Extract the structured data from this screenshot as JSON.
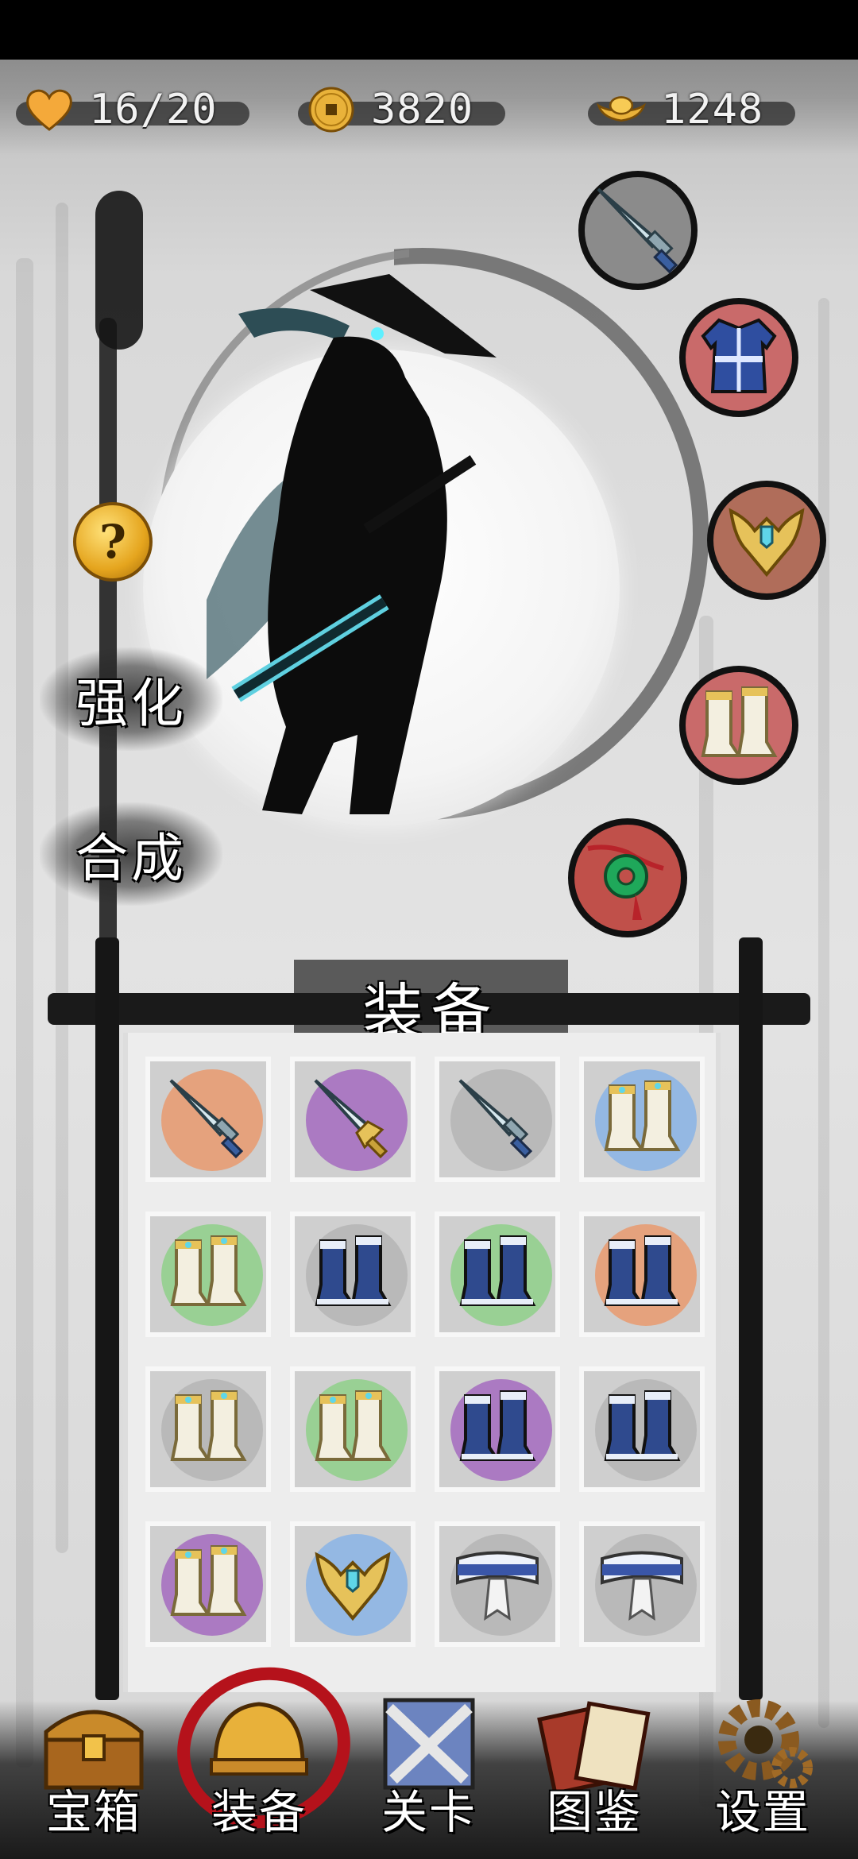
{
  "resources": {
    "stamina": {
      "icon": "heart-icon",
      "value": "16/20"
    },
    "coins": {
      "icon": "coin-icon",
      "value": "3820"
    },
    "gold_ingots": {
      "icon": "gold-ingot-icon",
      "value": "1248"
    }
  },
  "character": {
    "name": "ninja-silhouette"
  },
  "help": {
    "label": "?"
  },
  "actions": {
    "enhance_label": "强化",
    "synthesize_label": "合成"
  },
  "equipped_slots": [
    {
      "slot": "weapon",
      "icon": "sword-icon",
      "bg": "#8b8b8b"
    },
    {
      "slot": "armor",
      "icon": "robe-icon",
      "bg": "#c96a6a"
    },
    {
      "slot": "helmet",
      "icon": "helmet-icon",
      "bg": "#b06d5a"
    },
    {
      "slot": "boots",
      "icon": "boots-icon",
      "bg": "#c96a6a"
    },
    {
      "slot": "accessory",
      "icon": "jade-pendant-icon",
      "bg": "#c0504a"
    }
  ],
  "inventory": {
    "title": "装备",
    "items": [
      {
        "icon": "sword-icon",
        "rarity_color": "#e99a6e"
      },
      {
        "icon": "golden-sword-icon",
        "rarity_color": "#a56bc0"
      },
      {
        "icon": "sword-icon",
        "rarity_color": "#b5b5b5"
      },
      {
        "icon": "white-boots-icon",
        "rarity_color": "#8ab4e6"
      },
      {
        "icon": "white-boots-icon",
        "rarity_color": "#8fd08a"
      },
      {
        "icon": "blue-boots-icon",
        "rarity_color": "#b5b5b5"
      },
      {
        "icon": "blue-boots-icon",
        "rarity_color": "#8fd08a"
      },
      {
        "icon": "blue-boots-icon",
        "rarity_color": "#e99a6e"
      },
      {
        "icon": "white-boots-icon",
        "rarity_color": "#b5b5b5"
      },
      {
        "icon": "white-boots-icon",
        "rarity_color": "#8fd08a"
      },
      {
        "icon": "blue-boots-icon",
        "rarity_color": "#a56bc0"
      },
      {
        "icon": "blue-boots-icon",
        "rarity_color": "#b5b5b5"
      },
      {
        "icon": "white-boots-icon",
        "rarity_color": "#a56bc0"
      },
      {
        "icon": "helmet-icon",
        "rarity_color": "#8ab4e6"
      },
      {
        "icon": "belt-icon",
        "rarity_color": "#b5b5b5"
      },
      {
        "icon": "belt-icon",
        "rarity_color": "#b5b5b5"
      }
    ]
  },
  "nav": [
    {
      "label": "宝箱",
      "icon": "treasure-chest-icon"
    },
    {
      "label": "装备",
      "icon": "helmet-icon",
      "active": true
    },
    {
      "label": "关卡",
      "icon": "crossed-swords-icon"
    },
    {
      "label": "图鉴",
      "icon": "book-icon"
    },
    {
      "label": "设置",
      "icon": "gear-icon"
    }
  ]
}
